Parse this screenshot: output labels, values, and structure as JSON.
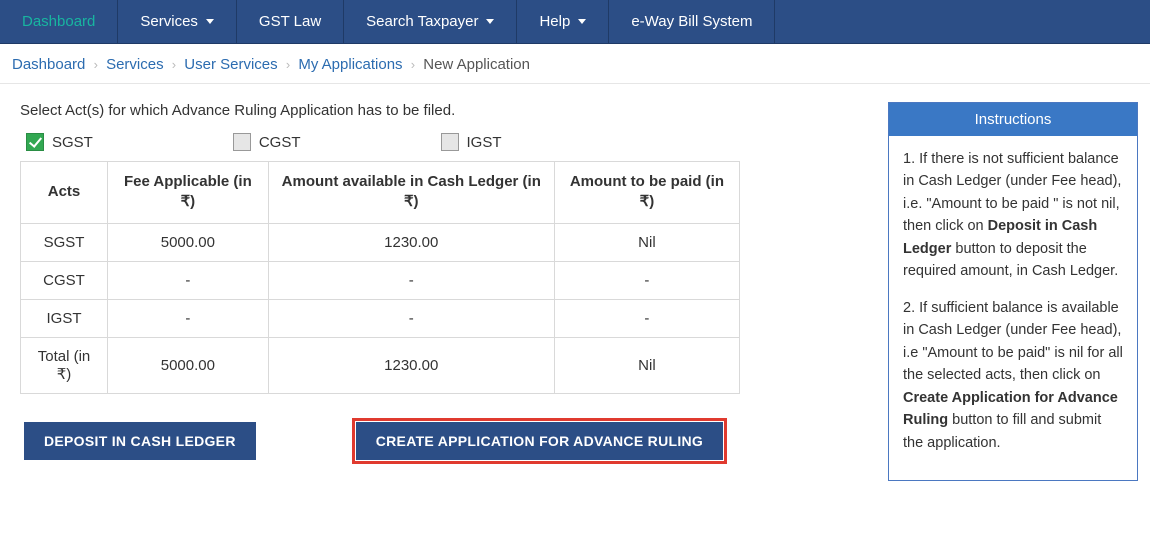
{
  "nav": {
    "dashboard": "Dashboard",
    "services": "Services",
    "gst_law": "GST Law",
    "search_taxpayer": "Search Taxpayer",
    "help": "Help",
    "eway": "e-Way Bill System"
  },
  "breadcrumb": {
    "items": [
      "Dashboard",
      "Services",
      "User Services",
      "My Applications"
    ],
    "current": "New Application"
  },
  "prompt": "Select Act(s) for which Advance Ruling Application has to be filed.",
  "acts_checkboxes": {
    "sgst": {
      "label": "SGST",
      "checked": true
    },
    "cgst": {
      "label": "CGST",
      "checked": false
    },
    "igst": {
      "label": "IGST",
      "checked": false
    }
  },
  "table": {
    "headers": {
      "acts": "Acts",
      "fee": "Fee Applicable (in ₹)",
      "cash": "Amount available in Cash Ledger (in ₹)",
      "paid": "Amount to be paid (in ₹)"
    },
    "rows": [
      {
        "act": "SGST",
        "fee": "5000.00",
        "cash": "1230.00",
        "paid": "Nil"
      },
      {
        "act": "CGST",
        "fee": "-",
        "cash": "-",
        "paid": "-"
      },
      {
        "act": "IGST",
        "fee": "-",
        "cash": "-",
        "paid": "-"
      }
    ],
    "total": {
      "label": "Total (in ₹)",
      "fee": "5000.00",
      "cash": "1230.00",
      "paid": "Nil"
    }
  },
  "buttons": {
    "deposit": "DEPOSIT IN CASH LEDGER",
    "create": "CREATE APPLICATION FOR ADVANCE RULING"
  },
  "instructions": {
    "title": "Instructions",
    "p1_pre": "1. If there is not sufficient balance in Cash Ledger (under Fee head), i.e. \"Amount to be paid \" is not nil, then click on ",
    "p1_bold": "Deposit in Cash Ledger",
    "p1_post": " button to deposit the required amount, in Cash Ledger.",
    "p2_pre": "2. If sufficient balance is available in Cash Ledger (under Fee head), i.e \"Amount to be paid\" is nil for all the selected acts, then click on ",
    "p2_bold": "Create Application for Advance Ruling",
    "p2_post": " button to fill and submit the application."
  }
}
